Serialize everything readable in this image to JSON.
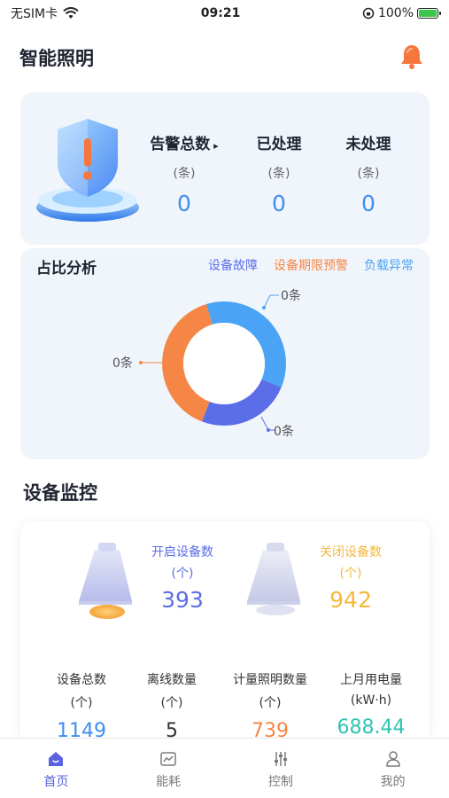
{
  "status_bar": {
    "carrier": "无SIM卡",
    "time": "09:21",
    "battery": "100%"
  },
  "page": {
    "title": "智能照明"
  },
  "alerts": {
    "total": {
      "label": "告警总数",
      "unit": "(条)",
      "value": "0"
    },
    "handled": {
      "label": "已处理",
      "unit": "(条)",
      "value": "0"
    },
    "unhandled": {
      "label": "未处理",
      "unit": "(条)",
      "value": "0"
    }
  },
  "ratio": {
    "title": "占比分析",
    "legend": [
      {
        "label": "设备故障",
        "color": "#5b6ee8"
      },
      {
        "label": "设备期限预警",
        "color": "#f58646"
      },
      {
        "label": "负载异常",
        "color": "#4aa3f5"
      }
    ],
    "labels": {
      "top": "0条",
      "left": "0条",
      "bottom": "0条"
    }
  },
  "monitor": {
    "title": "设备监控",
    "on": {
      "label": "开启设备数",
      "unit": "(个)",
      "value": "393",
      "color": "#5b6ee8"
    },
    "off": {
      "label": "关闭设备数",
      "unit": "(个)",
      "value": "942",
      "color": "#f5b83c"
    },
    "stats": [
      {
        "label": "设备总数",
        "unit": "(个)",
        "value": "1149",
        "color": "#3f8ef0"
      },
      {
        "label": "离线数量",
        "unit": "(个)",
        "value": "5",
        "color": "#333333"
      },
      {
        "label": "计量照明数量",
        "unit": "(个)",
        "value": "739",
        "color": "#f58646"
      },
      {
        "label": "上月用电量",
        "unit": "(kW·h)",
        "value": "688.44",
        "color": "#2fc4b2"
      }
    ]
  },
  "tabs": [
    {
      "label": "首页",
      "icon": "home-icon",
      "active": true
    },
    {
      "label": "能耗",
      "icon": "chart-icon",
      "active": false
    },
    {
      "label": "控制",
      "icon": "sliders-icon",
      "active": false
    },
    {
      "label": "我的",
      "icon": "user-icon",
      "active": false
    }
  ]
}
